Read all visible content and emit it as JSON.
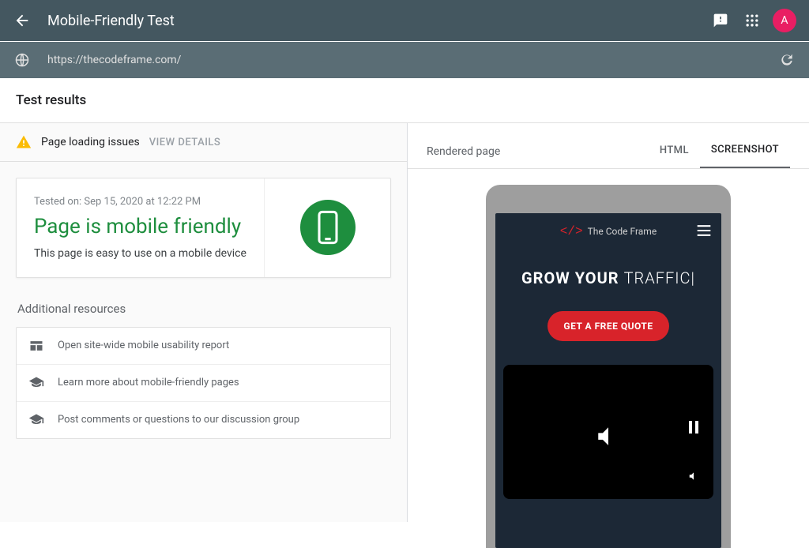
{
  "header": {
    "title": "Mobile-Friendly Test",
    "avatar_letter": "A"
  },
  "url_bar": {
    "url": "https://thecodeframe.com/"
  },
  "section_title": "Test results",
  "loading_issues": {
    "text": "Page loading issues",
    "view_details": "VIEW DETAILS"
  },
  "result": {
    "tested_on": "Tested on: Sep 15, 2020 at 12:22 PM",
    "verdict": "Page is mobile friendly",
    "subtitle": "This page is easy to use on a mobile device"
  },
  "resources": {
    "title": "Additional resources",
    "items": [
      "Open site-wide mobile usability report",
      "Learn more about mobile-friendly pages",
      "Post comments or questions to our discussion group"
    ]
  },
  "right": {
    "rendered_label": "Rendered page",
    "tabs": {
      "html": "HTML",
      "screenshot": "SCREENSHOT"
    }
  },
  "preview": {
    "brand": "The Code Frame",
    "hero_bold": "GROW YOUR",
    "hero_thin": "TRAFFIC|",
    "cta": "GET A FREE QUOTE"
  }
}
